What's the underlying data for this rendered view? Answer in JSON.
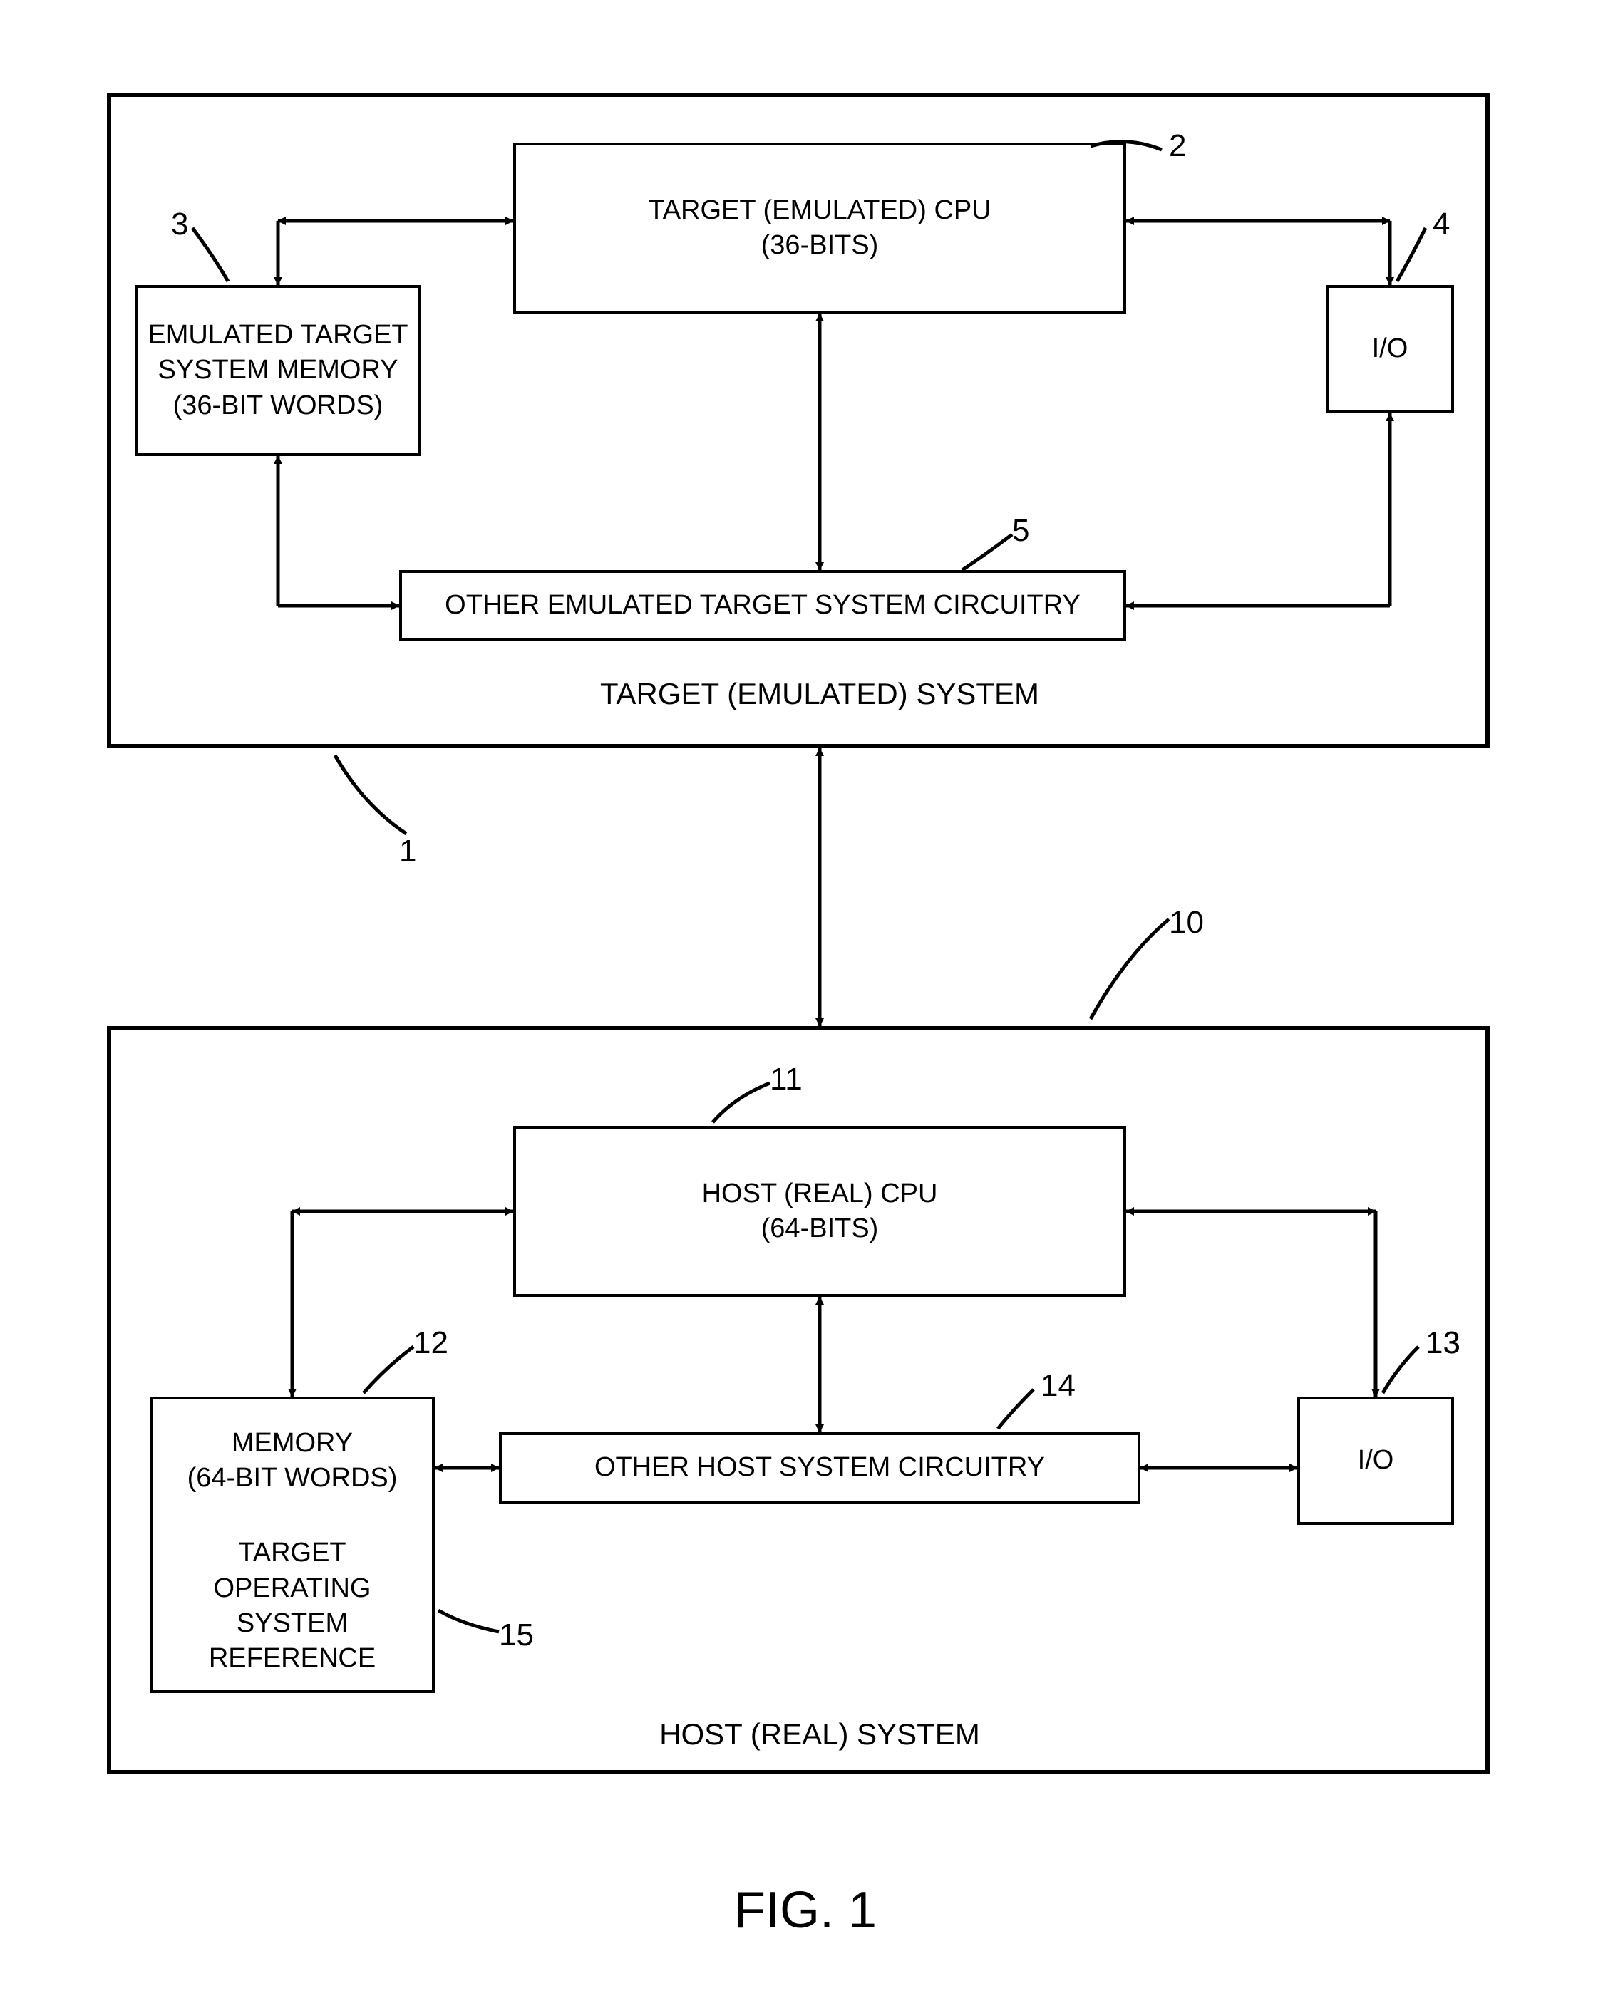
{
  "figure_label": "FIG. 1",
  "target_system": {
    "title": "TARGET  (EMULATED)  SYSTEM",
    "ref": "1",
    "cpu": {
      "line1": "TARGET (EMULATED)  CPU",
      "line2": "(36-BITS)",
      "ref": "2"
    },
    "memory": {
      "line1": "EMULATED TARGET",
      "line2": "SYSTEM MEMORY",
      "line3": "(36-BIT WORDS)",
      "ref": "3"
    },
    "io": {
      "label": "I/O",
      "ref": "4"
    },
    "other": {
      "label": "OTHER EMULATED TARGET SYSTEM CIRCUITRY",
      "ref": "5"
    }
  },
  "host_system": {
    "title": "HOST (REAL)  SYSTEM",
    "ref": "10",
    "cpu": {
      "line1": "HOST (REAL) CPU",
      "line2": "(64-BITS)",
      "ref": "11"
    },
    "memory": {
      "line1": "MEMORY",
      "line2": "(64-BIT WORDS)",
      "ref": "12"
    },
    "target_ref": {
      "line1": "TARGET",
      "line2": "OPERATING",
      "line3": "SYSTEM",
      "line4": "REFERENCE",
      "ref": "15"
    },
    "io": {
      "label": "I/O",
      "ref": "13"
    },
    "other": {
      "label": "OTHER HOST SYSTEM CIRCUITRY",
      "ref": "14"
    }
  }
}
